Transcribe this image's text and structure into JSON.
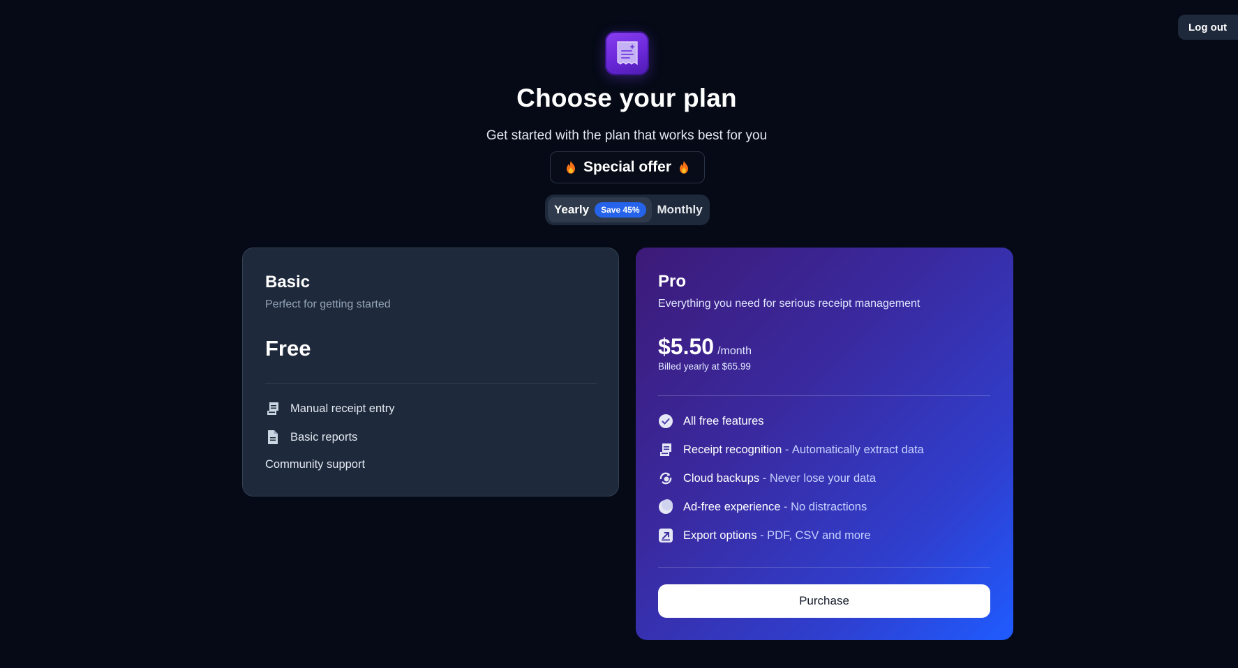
{
  "header": {
    "logout_label": "Log out",
    "title": "Choose your plan",
    "subtitle": "Get started with the plan that works best for you",
    "offer_label": "Special offer"
  },
  "billing_toggle": {
    "yearly_label": "Yearly",
    "save_badge": "Save 45%",
    "monthly_label": "Monthly",
    "selected": "Yearly"
  },
  "plans": {
    "basic": {
      "name": "Basic",
      "description": "Perfect for getting started",
      "price": "Free",
      "features": [
        {
          "name": "Manual receipt entry",
          "icon": "receipt-icon"
        },
        {
          "name": "Basic reports",
          "icon": "document-icon"
        },
        {
          "name": "Community support",
          "icon": ""
        }
      ]
    },
    "pro": {
      "name": "Pro",
      "description": "Everything you need for serious receipt management",
      "price": "$5.50",
      "period": "/month",
      "billing_note": "Billed yearly at $65.99",
      "separator": " - ",
      "features": [
        {
          "name": "All free features",
          "desc": "",
          "icon": "check-circle-icon"
        },
        {
          "name": "Receipt recognition",
          "desc": "Automatically extract data",
          "icon": "receipt-icon"
        },
        {
          "name": "Cloud backups",
          "desc": "Never lose your data",
          "icon": "cloud-sync-icon"
        },
        {
          "name": "Ad-free experience",
          "desc": "No distractions",
          "icon": "moon-icon"
        },
        {
          "name": "Export options",
          "desc": "PDF, CSV and more",
          "icon": "export-icon"
        }
      ],
      "purchase_label": "Purchase"
    }
  },
  "colors": {
    "background": "#050a16",
    "card_basic": "#1e293b",
    "accent_blue": "#2563eb",
    "pro_gradient_start": "#3d1a78",
    "pro_gradient_end": "#1f5cff"
  }
}
